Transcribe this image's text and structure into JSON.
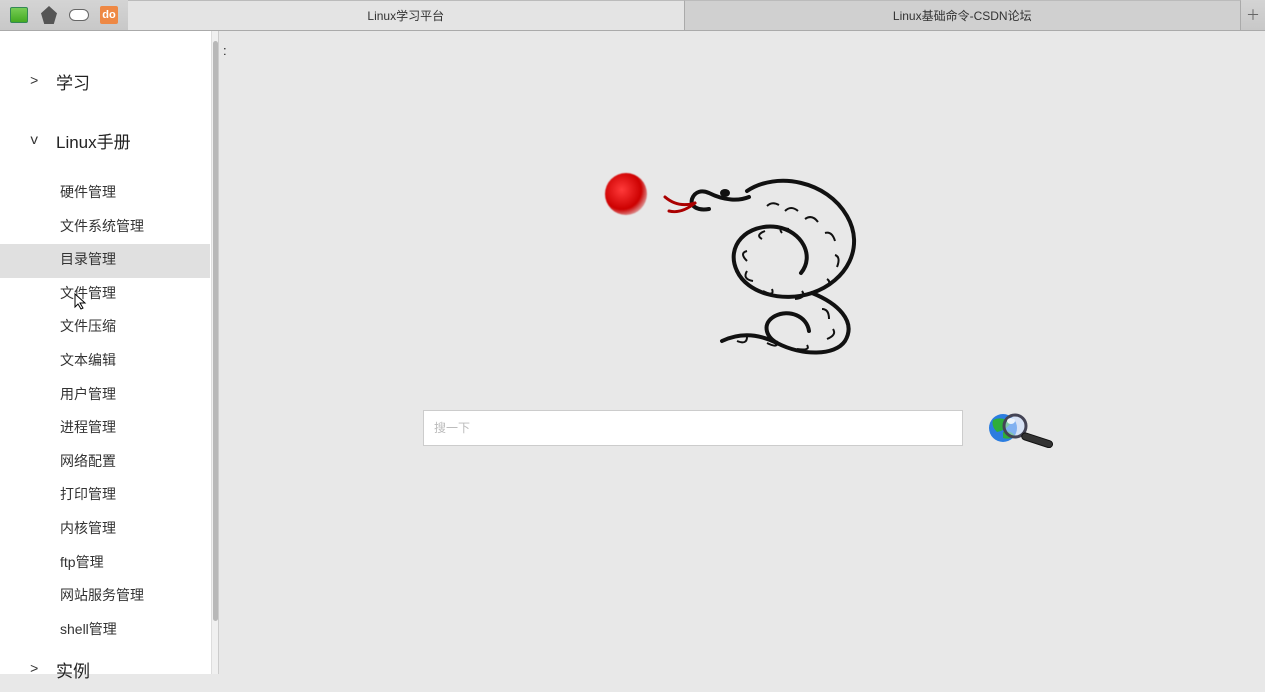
{
  "tabs": {
    "active": "Linux学习平台",
    "inactive": "Linux基础命令-CSDN论坛"
  },
  "toolbar_do": "do",
  "sidebar": {
    "groups": [
      {
        "chevron": ">",
        "label": "学习",
        "sub": []
      },
      {
        "chevron": "v",
        "label": "Linux手册",
        "sub": [
          "硬件管理",
          "文件系统管理",
          "目录管理",
          "文件管理",
          "文件压缩",
          "文本编辑",
          "用户管理",
          "进程管理",
          "网络配置",
          "打印管理",
          "内核管理",
          "ftp管理",
          "网站服务管理",
          "shell管理"
        ],
        "selected": 2
      },
      {
        "chevron": ">",
        "label": "实例",
        "sub": []
      }
    ]
  },
  "content": {
    "colon": ":",
    "search_placeholder": "搜一下"
  }
}
